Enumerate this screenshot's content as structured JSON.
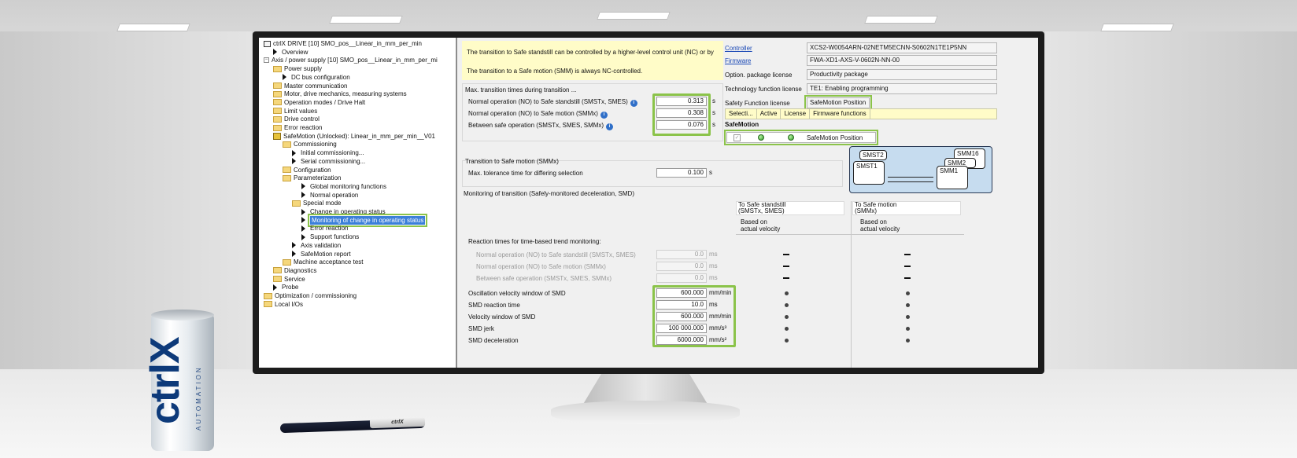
{
  "can": {
    "brand": "ctrlX",
    "sub": "AUTOMATION"
  },
  "pen": {
    "brand": "ctrlX"
  },
  "tree": {
    "items": [
      {
        "label": "ctrlX DRIVE [10] SMO_pos__Linear_in_mm_per_min",
        "icon": "drive-icon",
        "indent": 0
      },
      {
        "label": "Overview",
        "icon": "play-icon",
        "indent": 1
      },
      {
        "label": "Axis / power supply [10] SMO_pos__Linear_in_mm_per_mi",
        "icon": "expand-icon",
        "indent": 0
      },
      {
        "label": "Power supply",
        "icon": "folder-icon",
        "indent": 1
      },
      {
        "label": "DC bus configuration",
        "icon": "play-icon",
        "indent": 2
      },
      {
        "label": "Master communication",
        "icon": "folder-icon",
        "indent": 1
      },
      {
        "label": "Motor, drive mechanics, measuring systems",
        "icon": "folder-icon",
        "indent": 1
      },
      {
        "label": "Operation modes / Drive Halt",
        "icon": "folder-icon",
        "indent": 1
      },
      {
        "label": "Limit values",
        "icon": "folder-icon",
        "indent": 1
      },
      {
        "label": "Drive control",
        "icon": "folder-icon",
        "indent": 1
      },
      {
        "label": "Error reaction",
        "icon": "folder-icon",
        "indent": 1
      },
      {
        "label": "SafeMotion (Unlocked): Linear_in_mm_per_min__V01",
        "icon": "lock-icon",
        "indent": 1
      },
      {
        "label": "Commissioning",
        "icon": "folder-icon",
        "indent": 2
      },
      {
        "label": "Initial commissioning...",
        "icon": "play-icon",
        "indent": 3
      },
      {
        "label": "Serial commissioning...",
        "icon": "play-icon",
        "indent": 3
      },
      {
        "label": "Configuration",
        "icon": "folder-icon",
        "indent": 2
      },
      {
        "label": "Parameterization",
        "icon": "folder-icon",
        "indent": 2
      },
      {
        "label": "Global monitoring functions",
        "icon": "play-icon",
        "indent": 4
      },
      {
        "label": "Normal operation",
        "icon": "play-icon",
        "indent": 4
      },
      {
        "label": "Special mode",
        "icon": "folder-icon",
        "indent": 3
      },
      {
        "label": "Change in operating status",
        "icon": "play-icon",
        "indent": 4
      },
      {
        "label": "Monitoring of change in operating status",
        "icon": "play-icon",
        "indent": 4,
        "selected": true
      },
      {
        "label": "Error reaction",
        "icon": "play-icon",
        "indent": 4
      },
      {
        "label": "Support functions",
        "icon": "play-icon",
        "indent": 4
      },
      {
        "label": "Axis validation",
        "icon": "play-icon",
        "indent": 3
      },
      {
        "label": "SafeMotion report",
        "icon": "play-icon",
        "indent": 3
      },
      {
        "label": "Machine acceptance test",
        "icon": "folder-icon",
        "indent": 2
      },
      {
        "label": "Diagnostics",
        "icon": "folder-icon",
        "indent": 1
      },
      {
        "label": "Service",
        "icon": "folder-icon",
        "indent": 1
      },
      {
        "label": "Probe",
        "icon": "play-icon",
        "indent": 1
      },
      {
        "label": "Optimization / commissioning",
        "icon": "folder-icon",
        "indent": 0
      },
      {
        "label": "Local I/Os",
        "icon": "folder-icon",
        "indent": 0
      }
    ]
  },
  "notice": {
    "line1": "The transition to Safe standstill can be controlled by a higher-level control unit (NC) or by",
    "line2": "The transition to a Safe motion (SMM) is always NC-controlled."
  },
  "info": {
    "controller_label": "Controller",
    "controller_value": "XCS2-W0054ARN-02NETM5ECNN-S0602N1TE1P5NN",
    "firmware_label": "Firmware",
    "firmware_value": "FWA-XD1-AXS-V-0602N-NN-00",
    "option_label": "Option. package license",
    "option_value": "Productivity package",
    "tech_label": "Technology function license",
    "tech_value": "TE1: Enabling programming",
    "safety_label": "Safety Function license",
    "safety_value": "SafeMotion Position",
    "tabs": [
      "Selecti...",
      "Active",
      "License",
      "Firmware functions"
    ],
    "safemotion_heading": "SafeMotion",
    "safemotion_row": "SafeMotion Position"
  },
  "diagram": {
    "states": [
      "SMST2",
      "SMST1",
      "SMM16",
      "SMM2",
      "SMM1"
    ]
  },
  "max_transition": {
    "heading": "Max. transition times during transition ...",
    "rows": [
      {
        "label": "Normal operation (NO) to Safe standstill (SMSTx, SMES)",
        "value": "0.313",
        "unit": "s"
      },
      {
        "label": "Normal operation (NO) to Safe motion (SMMx)",
        "value": "0.308",
        "unit": "s"
      },
      {
        "label": "Between safe operation (SMSTx, SMES, SMMx)",
        "value": "0.076",
        "unit": "s"
      }
    ]
  },
  "transition_smm": {
    "heading": "Transition to Safe motion (SMMx)",
    "label": "Max. tolerance time for differing selection",
    "value": "0.100",
    "unit": "s"
  },
  "monitoring": {
    "heading": "Monitoring of transition (Safely-monitored deceleration, SMD)",
    "col1_head": "To Safe standstill (SMSTx, SMES)",
    "col1_line1": "To Safe standstill",
    "col1_line2": "(SMSTx, SMES)",
    "col2_line1": "To Safe motion",
    "col2_line2": "(SMMx)",
    "col1_based1": "Based on",
    "col1_based2": "actual velocity",
    "col2_based1": "Based on",
    "col2_based2": "actual velocity",
    "reaction_heading": "Reaction times for time-based trend monitoring:",
    "reaction_rows": [
      {
        "label": "Normal operation (NO) to Safe standstill (SMSTx, SMES)",
        "value": "0.0",
        "unit": "ms"
      },
      {
        "label": "Normal operation (NO) to Safe motion (SMMx)",
        "value": "0.0",
        "unit": "ms"
      },
      {
        "label": "Between safe operation (SMSTx, SMES, SMMx)",
        "value": "0.0",
        "unit": "ms"
      }
    ],
    "smd_rows": [
      {
        "label": "Oscillation velocity window of SMD",
        "value": "600.000",
        "unit": "mm/min"
      },
      {
        "label": "SMD reaction time",
        "value": "10.0",
        "unit": "ms"
      },
      {
        "label": "Velocity window of SMD",
        "value": "600.000",
        "unit": "mm/min"
      },
      {
        "label": "SMD jerk",
        "value": "100 000.000",
        "unit": "mm/s³"
      },
      {
        "label": "SMD deceleration",
        "value": "6000.000",
        "unit": "mm/s²"
      }
    ]
  },
  "colors": {
    "highlight": "#8bc34a",
    "selection": "#3b7fd9",
    "notice_bg": "#fffcc8"
  }
}
